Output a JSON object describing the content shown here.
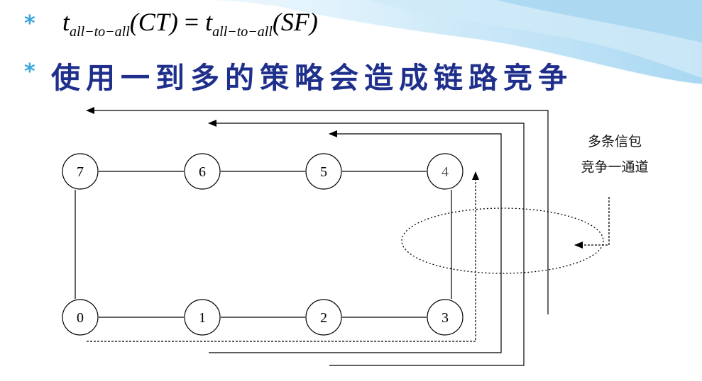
{
  "bullet_symbol": "*",
  "formula": {
    "t": "t",
    "sub": "all−to−all",
    "arg_left": "(CT)",
    "equals": " = ",
    "arg_right": "(SF)"
  },
  "heading": "使用一到多的策略会造成链路竞争",
  "nodes": {
    "n0": "0",
    "n1": "1",
    "n2": "2",
    "n3": "3",
    "n4": "4",
    "n5": "5",
    "n6": "6",
    "n7": "7"
  },
  "annotation": {
    "line1": "多条信包",
    "line2": "竞争一通道"
  },
  "colors": {
    "bullet": "#3aa6dc",
    "heading": "#1f2f8c",
    "wave_light": "#dff1fb",
    "wave_mid": "#bfe3f6",
    "wave_dark": "#94cdee"
  }
}
